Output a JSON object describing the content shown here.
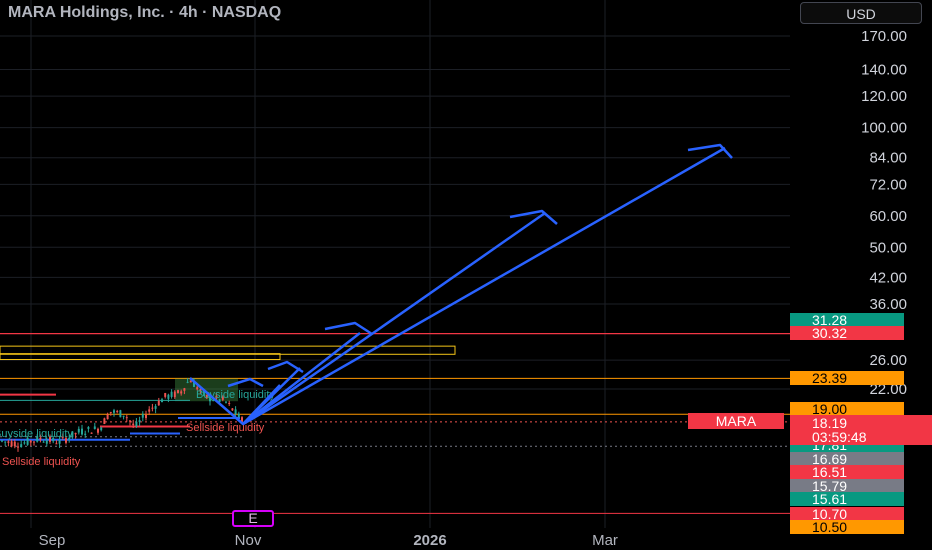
{
  "header": {
    "title": "MARA Holdings, Inc. · 4h · NASDAQ",
    "currency": "USD"
  },
  "colors": {
    "background": "#000000",
    "grid": "#1c1f26",
    "up": "#26a69a",
    "down": "#ef5350",
    "projection": "#2962ff",
    "zone": "#ff9800",
    "sell_level": "#f23645"
  },
  "chart_data": {
    "type": "candlestick",
    "symbol_tag": "MARA",
    "last_price": "18.19",
    "countdown": "03:59:48",
    "scale": "log",
    "x_labels": [
      "Sep",
      "Nov",
      "2026",
      "Mar"
    ],
    "y_ticks": [
      "170.00",
      "140.00",
      "120.00",
      "100.00",
      "84.00",
      "72.00",
      "60.00",
      "50.00",
      "42.00",
      "36.00",
      "26.00",
      "22.00"
    ],
    "price_tags": [
      {
        "value": "31.28",
        "color": "#089981",
        "text_color": "#ffffff"
      },
      {
        "value": "30.32",
        "color": "#f23645",
        "text_color": "#ffffff"
      },
      {
        "value": "23.39",
        "color": "#ff9800",
        "text_color": "#000000"
      },
      {
        "value": "19.00",
        "color": "#ff9800",
        "text_color": "#000000"
      },
      {
        "value": "17.81",
        "color": "#089981",
        "text_color": "#ffffff"
      },
      {
        "value": "16.69",
        "color": "#787b86",
        "text_color": "#ffffff"
      },
      {
        "value": "16.51",
        "color": "#f23645",
        "text_color": "#ffffff"
      },
      {
        "value": "15.79",
        "color": "#787b86",
        "text_color": "#ffffff"
      },
      {
        "value": "15.61",
        "color": "#089981",
        "text_color": "#ffffff"
      },
      {
        "value": "10.70",
        "color": "#f23645",
        "text_color": "#ffffff"
      },
      {
        "value": "10.50",
        "color": "#ff9800",
        "text_color": "#000000"
      }
    ],
    "annotations": [
      "Sellside liquidity",
      "Buyside liquidity",
      "Sellside liquidity",
      "Buyside liquidity"
    ],
    "earnings_marker": "E"
  }
}
